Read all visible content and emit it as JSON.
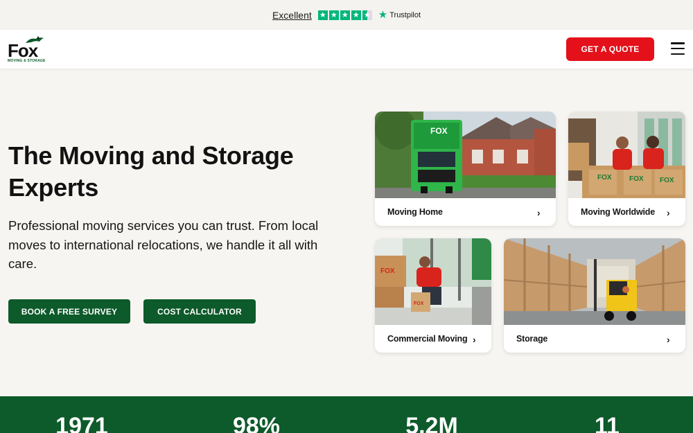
{
  "trustpilot": {
    "rating_label": "Excellent",
    "stars_filled": 4.5,
    "brand": "Trustpilot"
  },
  "header": {
    "logo_text": "Fox",
    "logo_sub": "MOVING & STORAGE",
    "quote_label": "GET A QUOTE",
    "menu_icon": "hamburger-menu-icon"
  },
  "hero": {
    "title_line1": "The Moving and Storage",
    "title_line2": "Experts",
    "subtitle": "Professional moving services you can trust. From local moves to international relocations, we handle it all with care.",
    "survey_label": "BOOK A FREE SURVEY",
    "calculator_label": "COST CALCULATOR"
  },
  "services": [
    {
      "label": "Moving Home"
    },
    {
      "label": "Moving Worldwide"
    },
    {
      "label": "Commercial Moving"
    },
    {
      "label": "Storage"
    }
  ],
  "stats": [
    "1971",
    "98%",
    "5.2M",
    "11"
  ],
  "colors": {
    "brand_green": "#0d5a2a",
    "accent_red": "#e4101a",
    "trustpilot_green": "#00b67a",
    "page_bg": "#f7f5f2"
  }
}
